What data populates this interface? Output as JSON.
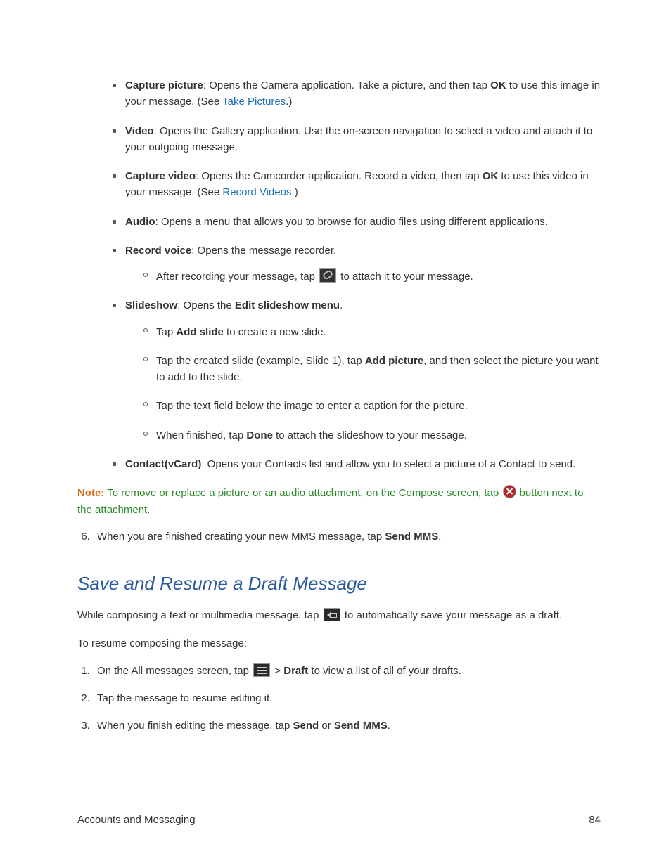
{
  "attachments": {
    "capture_picture": {
      "label": "Capture picture",
      "text1": ": Opens the Camera application. Take a picture, and then tap ",
      "ok": "OK",
      "text2": " to use this image in your message. (See ",
      "link": "Take Pictures",
      "text3": ".)"
    },
    "video": {
      "label": "Video",
      "text": ": Opens the Gallery application. Use the on-screen navigation to select a video and attach it to your outgoing message."
    },
    "capture_video": {
      "label": "Capture video",
      "text1": ": Opens the Camcorder application. Record a video, then tap ",
      "ok": "OK",
      "text2": " to use this video in your message. (See ",
      "link": "Record Videos",
      "text3": ".)"
    },
    "audio": {
      "label": "Audio",
      "text": ": Opens a menu that allows you to browse for audio files using different applications."
    },
    "record_voice": {
      "label": "Record voice",
      "text": ": Opens the message recorder.",
      "sub1a": "After recording your message, tap ",
      "sub1b": " to attach it to your message."
    },
    "slideshow": {
      "label": "Slideshow",
      "text1": ": Opens the ",
      "menu": "Edit slideshow menu",
      "text2": ".",
      "s1a": "Tap ",
      "s1bold": "Add slide",
      "s1b": " to create a new slide.",
      "s2a": "Tap the created slide (example, Slide 1), tap ",
      "s2bold": "Add picture",
      "s2b": ", and then select the picture you want to add to the slide.",
      "s3": "Tap the text field below the image to enter a caption for the picture.",
      "s4a": "When finished, tap ",
      "s4bold": "Done",
      "s4b": " to attach the slideshow to your message."
    },
    "contact": {
      "label": "Contact(vCard)",
      "text": ": Opens your Contacts list and allow you to select a picture of a Contact to send."
    }
  },
  "note": {
    "label": "Note:",
    "text1": "  To remove or replace a picture or an audio attachment, on the Compose screen, tap ",
    "text2": " button next to the attachment."
  },
  "step6": {
    "a": "When you are finished creating your new MMS message, tap ",
    "bold": "Send MMS",
    "b": "."
  },
  "section2": {
    "heading": "Save and Resume a Draft Message",
    "intro_a": "While composing a text or multimedia message, tap ",
    "intro_b": " to automatically save your message as a draft.",
    "resume": "To resume composing the message:",
    "s1a": "On the All messages screen, tap ",
    "s1b": " > ",
    "s1bold": "Draft",
    "s1c": " to view a list of all of your drafts.",
    "s2": "Tap the message to resume editing it.",
    "s3a": "When you finish editing the message, tap ",
    "s3bold1": "Send",
    "s3b": " or ",
    "s3bold2": "Send MMS",
    "s3c": "."
  },
  "footer": {
    "left": "Accounts and Messaging",
    "right": "84"
  }
}
